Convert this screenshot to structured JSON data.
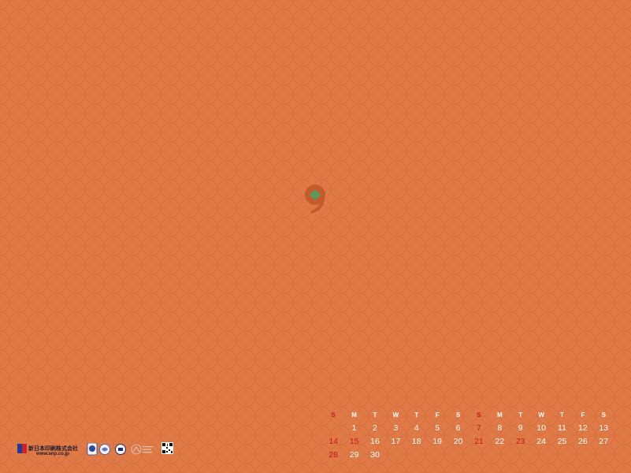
{
  "wallpaper": {
    "background_color": "#e07b48",
    "pattern": "shippo-circles",
    "month_glyph": "9"
  },
  "calendar": {
    "day_headers": [
      "S",
      "M",
      "T",
      "W",
      "T",
      "F",
      "S",
      "S",
      "M",
      "T",
      "W",
      "T",
      "F",
      "S"
    ],
    "weeks": [
      [
        "",
        "1",
        "2",
        "3",
        "4",
        "5",
        "6",
        "7",
        "8",
        "9",
        "10",
        "11",
        "12",
        "13"
      ],
      [
        "14",
        "15",
        "16",
        "17",
        "18",
        "19",
        "20",
        "21",
        "22",
        "23",
        "24",
        "25",
        "26",
        "27"
      ],
      [
        "28",
        "29",
        "30",
        "",
        "",
        "",
        "",
        "",
        "",
        "",
        "",
        "",
        "",
        ""
      ]
    ],
    "red_dates": [
      "7",
      "14",
      "15",
      "21",
      "23",
      "28"
    ],
    "sunday_color": "#c8141e",
    "weekday_color": "#ffffff"
  },
  "footer": {
    "company_name": "新日本印刷株式会社",
    "url": "www.snp.co.jp",
    "icons": [
      "company-logo-icon",
      "certification-badge-icon",
      "certification-badge-icon",
      "certification-badge-icon",
      "science-based-targets-icon",
      "qr-code-icon"
    ]
  }
}
